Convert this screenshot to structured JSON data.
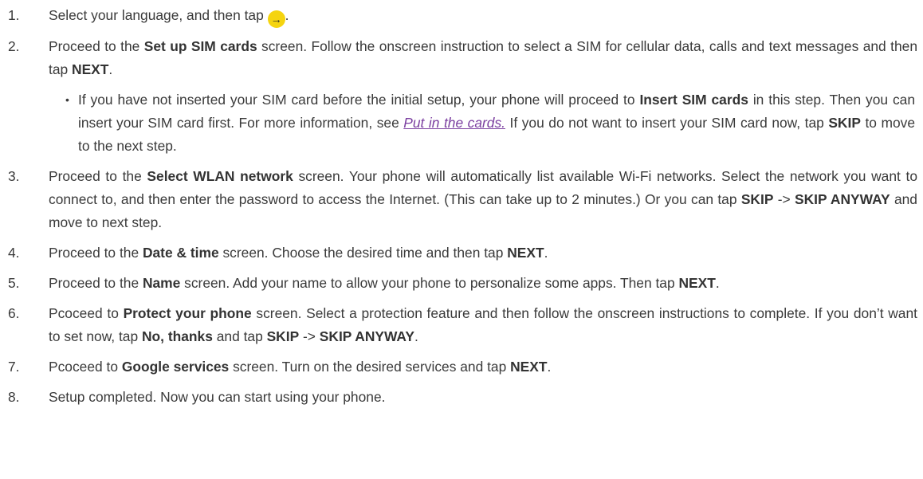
{
  "steps": [
    {
      "num": "1.",
      "a": "Select your language, and then tap ",
      "icon": "→",
      "b": "."
    },
    {
      "num": "2.",
      "a": "Proceed to the ",
      "b1": "Set up SIM cards",
      "c": " screen. Follow the onscreen instruction to select a SIM for cellular data, calls and text messages and then tap ",
      "b2": "NEXT",
      "d": "."
    },
    {
      "num": "3.",
      "a": "Proceed to the ",
      "b1": "Select WLAN network",
      "c": " screen. Your phone will automatically list available Wi-Fi networks. Select the network you want to connect to, and then enter the password to access the Internet. (This can take up to 2 minutes.) Or you can tap ",
      "b2": "SKIP",
      "d": " -> ",
      "b3": "SKIP ANYWAY",
      "e": " and move to next step."
    },
    {
      "num": "4.",
      "a": "Proceed to the ",
      "b1": "Date & time",
      "c": " screen. Choose the desired time and then tap ",
      "b2": "NEXT",
      "d": "."
    },
    {
      "num": "5.",
      "a": "Proceed to the ",
      "b1": "Name",
      "c": " screen. Add your name to allow your phone to personalize some apps. Then tap ",
      "b2": "NEXT",
      "d": "."
    },
    {
      "num": "6.",
      "a": "Pcoceed to ",
      "b1": "Protect your phone",
      "c": " screen. Select a protection feature and then follow the onscreen instructions to complete. If you don’t want to set now, tap ",
      "b2": "No, thanks",
      "d": " and tap ",
      "b3": "SKIP",
      "e": " -> ",
      "b4": "SKIP ANYWAY",
      "f": "."
    },
    {
      "num": "7.",
      "a": "Pcoceed to ",
      "b1": "Google services",
      "c": " screen. Turn on the desired services and tap ",
      "b2": "NEXT",
      "d": "."
    },
    {
      "num": "8.",
      "a": "Setup completed. Now you can start using your phone."
    }
  ],
  "sub": {
    "bullet": "•",
    "a": "If you have not inserted your SIM card before the initial setup, your phone will proceed to ",
    "b1": "Insert SIM cards",
    "c": " in this step. Then you can insert your SIM card first. For more information, see ",
    "link": "Put in the cards.",
    "d": " If you do not want to insert your SIM card now, tap ",
    "b2": "SKIP",
    "e": " to move to the next step."
  },
  "colors": {
    "text": "#3a3a3a",
    "link": "#7b3fa0",
    "accent": "#f5d40f"
  }
}
